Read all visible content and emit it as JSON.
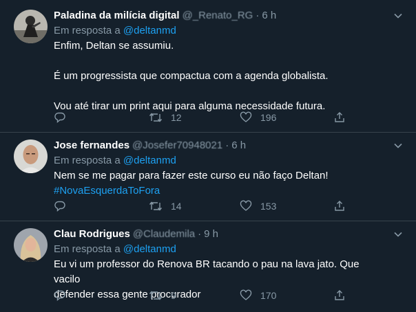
{
  "tweets": [
    {
      "name": "Paladina da milícia digital",
      "handle": "@_Renato_RG",
      "dot": "·",
      "time": "6 h",
      "reply_prefix": "Em resposta a",
      "reply_to": "@deltanmd",
      "lines": [
        "Enfim, Deltan se assumiu.",
        "É um progressista que compactua com a agenda globalista.",
        "Vou até tirar um print aqui para alguma necessidade futura."
      ],
      "retweets": "12",
      "likes": "196"
    },
    {
      "name": "Jose fernandes",
      "handle": "@Josefer70948021",
      "dot": "·",
      "time": "6 h",
      "reply_prefix": "Em resposta a",
      "reply_to": "@deltanmd",
      "lines": [
        "Nem se me pagar para fazer este curso eu não faço Deltan!"
      ],
      "hashtag": "#NovaEsquerdaToFora",
      "retweets": "14",
      "likes": "153"
    },
    {
      "name": "Clau Rodrigues",
      "handle": "@Claudemila",
      "dot": "·",
      "time": "9 h",
      "reply_prefix": "Em resposta a",
      "reply_to": "@deltanmd",
      "lines": [
        "Eu vi um professor do Renova BR tacando o pau na lava jato. Que vacilo",
        "defender essa gente procurador"
      ],
      "retweets": "9",
      "likes": "170"
    }
  ],
  "icons": {
    "reply": "reply-icon",
    "retweet": "retweet-icon",
    "like": "heart-icon",
    "share": "share-icon",
    "more": "chevron-down-icon"
  },
  "colors": {
    "background": "#15202b",
    "border": "#38444d",
    "secondary_text": "#8899a6",
    "accent": "#1da1f2"
  }
}
